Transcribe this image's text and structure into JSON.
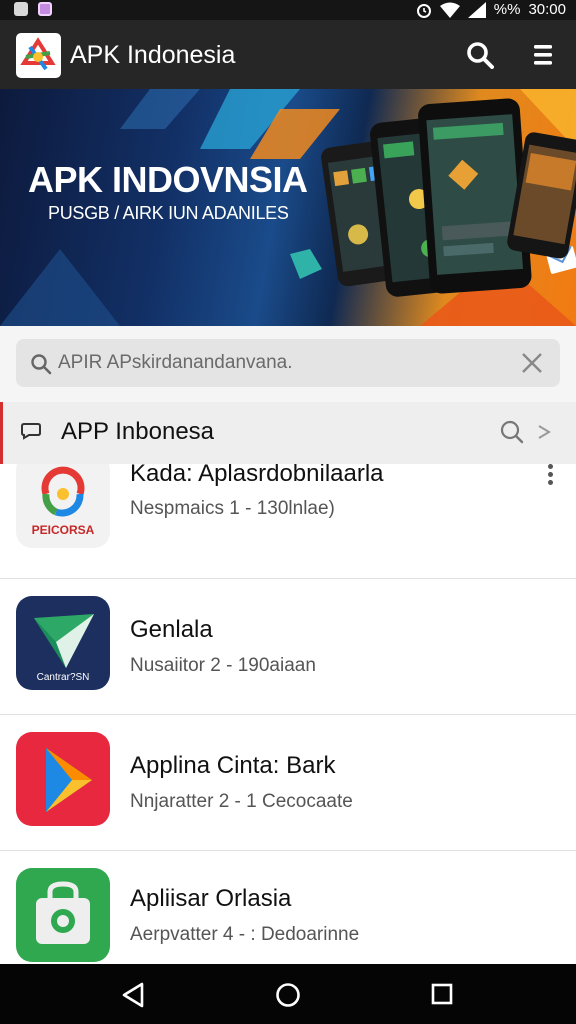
{
  "status_bar": {
    "left_icons": [
      "notification-icon",
      "app-notification-icon"
    ],
    "alarm_icon": "alarm-icon",
    "wifi_icon": "wifi-icon",
    "signal_icon": "signal-icon",
    "battery_text": "%%",
    "time": "30:00"
  },
  "app_bar": {
    "title": "APK Indonesia",
    "logo_icon": "apk-logo-icon",
    "search_icon": "search-icon",
    "menu_icon": "menu-icon"
  },
  "banner": {
    "title": "APK INDOVNSIA",
    "subtitle": "PUSGB / AIRK IUN ADANILES"
  },
  "search": {
    "placeholder": "APIR APskirdanandanvana.",
    "value": ""
  },
  "section": {
    "title": "APP Inbonesa"
  },
  "apps": [
    {
      "title": "Kada: Aplasrdobnilaarla",
      "subtitle": "Nespmaics 1 - 130lnlae)",
      "icon_text": "PEICORSA",
      "icon": "colorful-logo-icon"
    },
    {
      "title": "Genlala",
      "subtitle": "Nusaiitor 2 - 190aiaan",
      "icon_text": "Cantrar?SN",
      "icon": "green-arrow-icon"
    },
    {
      "title": "Applina Cinta: Bark",
      "subtitle": "Nnjaratter 2 - 1 Cecocaate",
      "icon_text": "",
      "icon": "play-triangle-icon"
    },
    {
      "title": "Apliisar Orlasia",
      "subtitle": "Aerpvatter 4 - : Dedoarinne",
      "icon_text": "",
      "icon": "shopping-bag-icon"
    }
  ],
  "nav_bar": {
    "back_icon": "back-icon",
    "home_icon": "home-icon",
    "recents_icon": "recents-icon"
  },
  "colors": {
    "app_bar": "#262626",
    "status_bar": "#151515",
    "section_accent": "#d32f2f",
    "search_bg": "#e4e4e4"
  }
}
